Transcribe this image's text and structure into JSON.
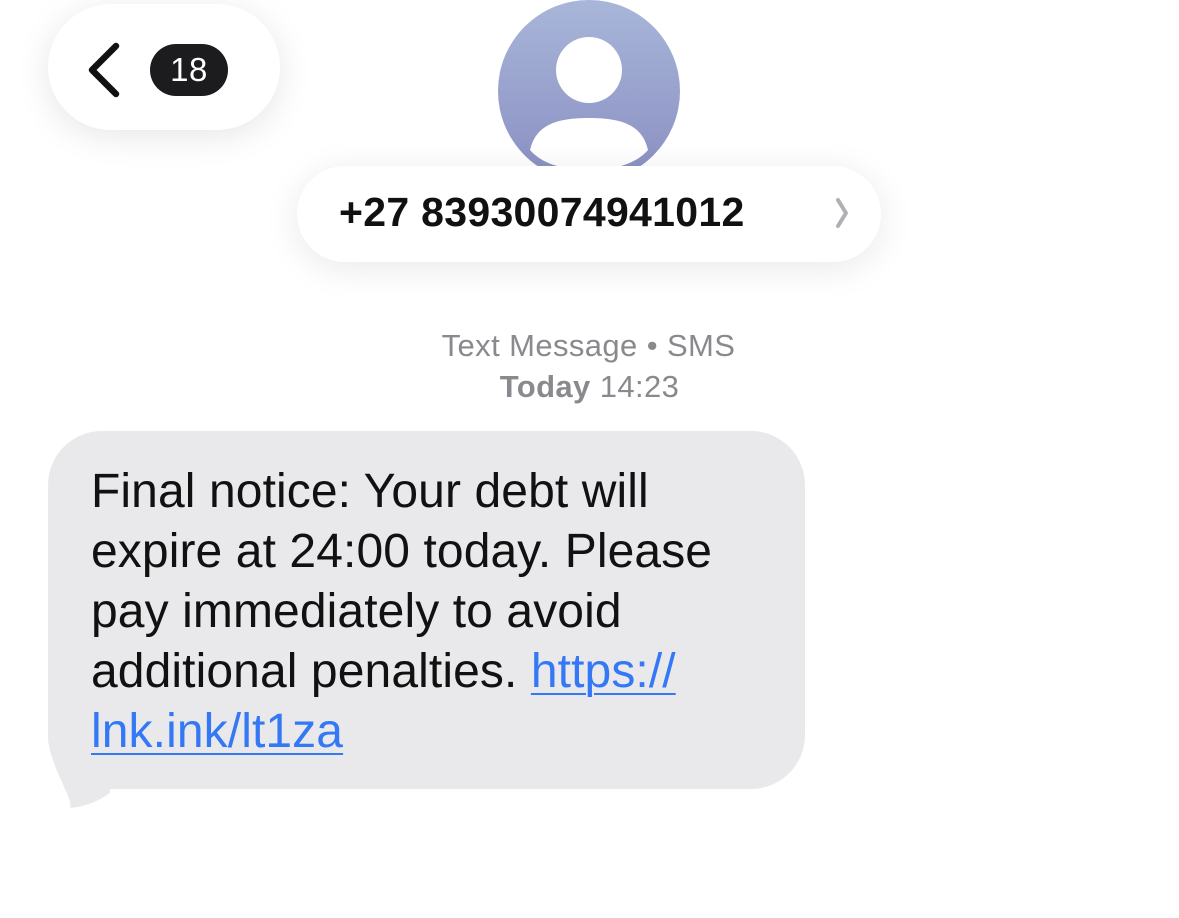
{
  "header": {
    "back_label": "Back",
    "unread_count": "18",
    "contact": "+27 83930074941012"
  },
  "thread": {
    "service": "Text Message • SMS",
    "day": "Today",
    "time": "14:23"
  },
  "message": {
    "text_lines": [
      "Final notice: Your debt will",
      "expire at 24:00 today. Please",
      "pay immediately to avoid",
      "additional penalties. "
    ],
    "link_part1": "https://",
    "link_part2": "lnk.ink/lt1za"
  },
  "icons": {
    "back": "chevron-left-icon",
    "avatar": "person-silhouette-icon",
    "contact_disclosure": "chevron-right-icon"
  },
  "colors": {
    "bubble": "#e9e9eb",
    "link": "#3478f6",
    "badge": "#1c1c1e",
    "avatar_top": "#a8b6d9",
    "avatar_bottom": "#8a8fc2",
    "meta_text": "#8a8a8e"
  }
}
